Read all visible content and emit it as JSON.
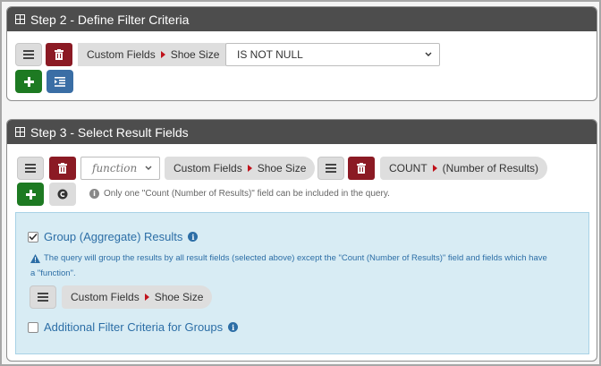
{
  "step2": {
    "title": "Step 2 - Define Filter Criteria",
    "criteria": {
      "field_group": "Custom Fields",
      "field_name": "Shoe Size",
      "operator_value": "IS NOT NULL"
    }
  },
  "step3": {
    "title": "Step 3 - Select Result Fields",
    "field1": {
      "function_placeholder": "function",
      "field_group": "Custom Fields",
      "field_name": "Shoe Size"
    },
    "field2": {
      "field_group": "COUNT",
      "field_name": "(Number of Results)"
    },
    "count_note": "Only one \"Count (Number of Results)\" field can be included in the query.",
    "group": {
      "checked": true,
      "label": "Group (Aggregate) Results",
      "description_line1": "The query will group the results by all result fields (selected above) except the \"Count (Number of Results)\" field and fields which have",
      "description_line2": "a \"function\".",
      "field_group": "Custom Fields",
      "field_name": "Shoe Size"
    },
    "additional": {
      "checked": false,
      "label": "Additional Filter Criteria for Groups"
    }
  },
  "colors": {
    "header": "#4d4d4d",
    "delete": "#8b1a24",
    "add": "#1d7a22",
    "blue": "#3a6ea5",
    "arrow": "#c0121b",
    "agg_bg": "#d8ecf4",
    "agg_text": "#2c6ea6"
  },
  "icons": [
    "grid-icon",
    "menu-icon",
    "trash-icon",
    "plus-icon",
    "indent-icon",
    "copyright-icon",
    "info-icon",
    "check-icon",
    "chevron-down-icon",
    "caret-right-icon"
  ]
}
